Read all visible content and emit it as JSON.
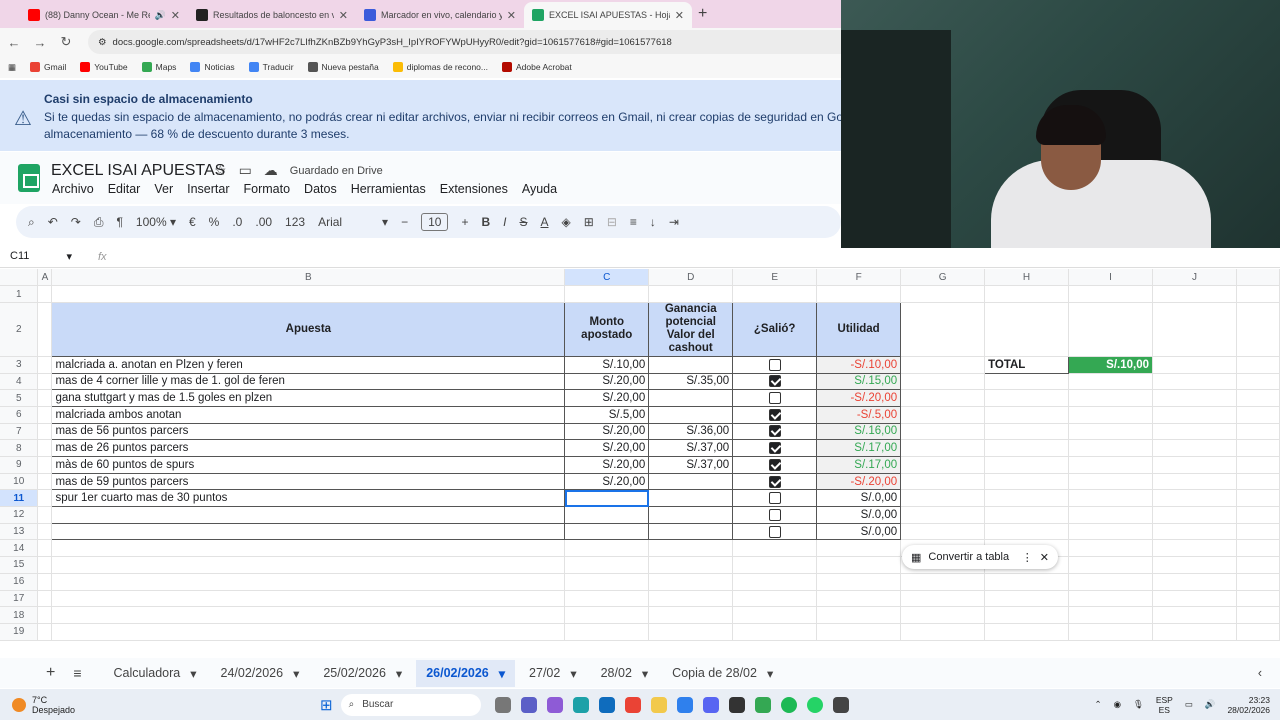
{
  "browser": {
    "tabs": [
      {
        "title": "(88) Danny Ocean - Me Rehúso",
        "color": "#ff0000"
      },
      {
        "title": "Resultados de baloncesto en vivo",
        "color": "#222222"
      },
      {
        "title": "Marcador en vivo, calendario y resultados",
        "color": "#3b5bdb"
      },
      {
        "title": "EXCEL ISAI APUESTAS - Hojas de cálculo",
        "color": "#1fa463"
      }
    ],
    "url": "docs.google.com/spreadsheets/d/17wHF2c7LIfhZKnBZb9YhGyP3sH_IpIYROFYWpUHyyR0/edit?gid=1061577618#gid=1061577618",
    "bookmarks": [
      "Gmail",
      "YouTube",
      "Maps",
      "Noticias",
      "Traducir",
      "Nueva pestaña",
      "diplomas de recono...",
      "Adobe Acrobat"
    ]
  },
  "banner": {
    "title": "Casi sin espacio de almacenamiento",
    "line1": "Si te quedas sin espacio de almacenamiento, no podrás crear ni editar archivos, enviar ni recibir correos en Gmail, ni crear copias de seguridad en Goog",
    "line2": "almacenamiento — 68 % de descuento durante 3 meses."
  },
  "doc": {
    "title": "EXCEL ISAI APUESTAS",
    "saved": "Guardado en Drive",
    "menu": [
      "Archivo",
      "Editar",
      "Ver",
      "Insertar",
      "Formato",
      "Datos",
      "Herramientas",
      "Extensiones",
      "Ayuda"
    ]
  },
  "toolbar": {
    "zoom": "100%",
    "currency": "€",
    "percent": "%",
    "dec_less": ".0",
    "dec_more": ".00",
    "format123": "123",
    "font": "Arial",
    "font_size": "10"
  },
  "formula": {
    "cell": "C11",
    "fx": "fx"
  },
  "columns": [
    "A",
    "B",
    "C",
    "D",
    "E",
    "F",
    "G",
    "H",
    "I",
    "J"
  ],
  "headers": {
    "apuesta": "Apuesta",
    "monto": "Monto apostado",
    "ganancia": "Ganancia potencial Valor del cashout",
    "salio": "¿Salió?",
    "utilidad": "Utilidad"
  },
  "rows": [
    {
      "n": "3",
      "apuesta": "malcriada a. anotan en Plzen y feren",
      "monto": "S/.10,00",
      "ganancia": "",
      "salio": false,
      "utilidad": "-S/.10,00",
      "sign": "neg"
    },
    {
      "n": "4",
      "apuesta": "mas de 4 corner lille y mas de 1. gol de feren",
      "monto": "S/.20,00",
      "ganancia": "S/.35,00",
      "salio": true,
      "utilidad": "S/.15,00",
      "sign": "pos"
    },
    {
      "n": "5",
      "apuesta": "gana stuttgart y mas de 1.5 goles en plzen",
      "monto": "S/.20,00",
      "ganancia": "",
      "salio": false,
      "utilidad": "-S/.20,00",
      "sign": "neg"
    },
    {
      "n": "6",
      "apuesta": "malcriada ambos anotan",
      "monto": "S/.5,00",
      "ganancia": "",
      "salio": true,
      "utilidad": "-S/.5,00",
      "sign": "neg"
    },
    {
      "n": "7",
      "apuesta": "mas de 56 puntos parcers",
      "monto": "S/.20,00",
      "ganancia": "S/.36,00",
      "salio": true,
      "utilidad": "S/.16,00",
      "sign": "pos"
    },
    {
      "n": "8",
      "apuesta": "mas de 26 puntos parcers",
      "monto": "S/.20,00",
      "ganancia": "S/.37,00",
      "salio": true,
      "utilidad": "S/.17,00",
      "sign": "pos"
    },
    {
      "n": "9",
      "apuesta": "màs de 60 puntos de spurs",
      "monto": "S/.20,00",
      "ganancia": "S/.37,00",
      "salio": true,
      "utilidad": "S/.17,00",
      "sign": "pos"
    },
    {
      "n": "10",
      "apuesta": "mas de 59 puntos parcers",
      "monto": "S/.20,00",
      "ganancia": "",
      "salio": true,
      "utilidad": "-S/.20,00",
      "sign": "neg"
    },
    {
      "n": "11",
      "apuesta": "spur 1er cuarto mas de 30 puntos",
      "monto": "",
      "ganancia": "",
      "salio": false,
      "utilidad": "S/.0,00",
      "sign": "zero"
    },
    {
      "n": "12",
      "apuesta": "",
      "monto": "",
      "ganancia": "",
      "salio": false,
      "utilidad": "S/.0,00",
      "sign": "zero"
    },
    {
      "n": "13",
      "apuesta": "",
      "monto": "",
      "ganancia": "",
      "salio": false,
      "utilidad": "S/.0,00",
      "sign": "zero"
    }
  ],
  "empty_rows": [
    "14",
    "15",
    "16",
    "17",
    "18",
    "19"
  ],
  "total": {
    "label": "TOTAL",
    "value": "S/.10,00"
  },
  "convert_label": "Convertir a tabla",
  "sheets": [
    "Calculadora",
    "24/02/2026",
    "25/02/2026",
    "26/02/2026",
    "27/02",
    "28/02",
    "Copia de 28/02"
  ],
  "active_sheet": "26/02/2026",
  "taskbar": {
    "temp": "7°C",
    "weather": "Despejado",
    "search": "Buscar",
    "lang1": "ESP",
    "lang2": "ES",
    "time": "23:23",
    "date": "28/02/2026"
  }
}
